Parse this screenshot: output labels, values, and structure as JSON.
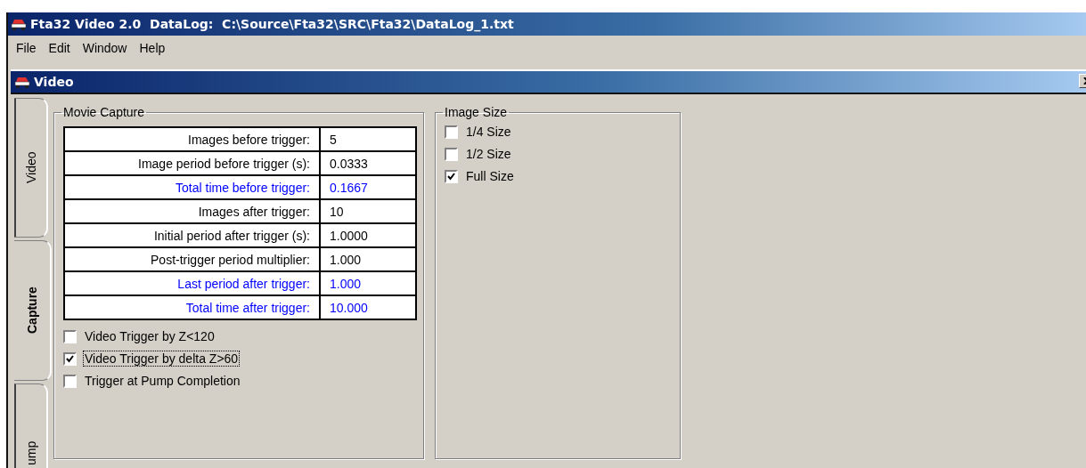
{
  "window": {
    "title": "Fta32 Video 2.0  DataLog:  C:\\Source\\Fta32\\SRC\\Fta32\\DataLog_1.txt"
  },
  "menu": [
    "File",
    "Edit",
    "Window",
    "Help"
  ],
  "child_window": {
    "title": "Video"
  },
  "tabs": [
    {
      "label": "Video",
      "selected": false
    },
    {
      "label": "Capture",
      "selected": true
    },
    {
      "label": "ump",
      "selected": false
    }
  ],
  "movie_capture": {
    "title": "Movie Capture",
    "rows": [
      {
        "label": "Images before trigger:",
        "value": "5",
        "kind": "input"
      },
      {
        "label": "Image period before trigger (s):",
        "value": "0.0333",
        "kind": "input"
      },
      {
        "label": "Total time before trigger:",
        "value": "0.1667",
        "kind": "computed"
      },
      {
        "label": "Images after trigger:",
        "value": "10",
        "kind": "input"
      },
      {
        "label": "Initial period after trigger (s):",
        "value": "1.0000",
        "kind": "input"
      },
      {
        "label": "Post-trigger period multiplier:",
        "value": "1.000",
        "kind": "input"
      },
      {
        "label": "Last period after trigger:",
        "value": "1.000",
        "kind": "computed"
      },
      {
        "label": "Total time after trigger:",
        "value": "10.000",
        "kind": "computed"
      }
    ],
    "options": [
      {
        "label": "Video Trigger by Z<120",
        "checked": false,
        "focused": false
      },
      {
        "label": "Video Trigger by delta Z>60",
        "checked": true,
        "focused": true
      },
      {
        "label": "Trigger at Pump Completion",
        "checked": false,
        "focused": false
      }
    ]
  },
  "image_size": {
    "title": "Image Size",
    "options": [
      {
        "label": "1/4 Size",
        "checked": false
      },
      {
        "label": "1/2 Size",
        "checked": false
      },
      {
        "label": "Full Size",
        "checked": true
      }
    ]
  }
}
